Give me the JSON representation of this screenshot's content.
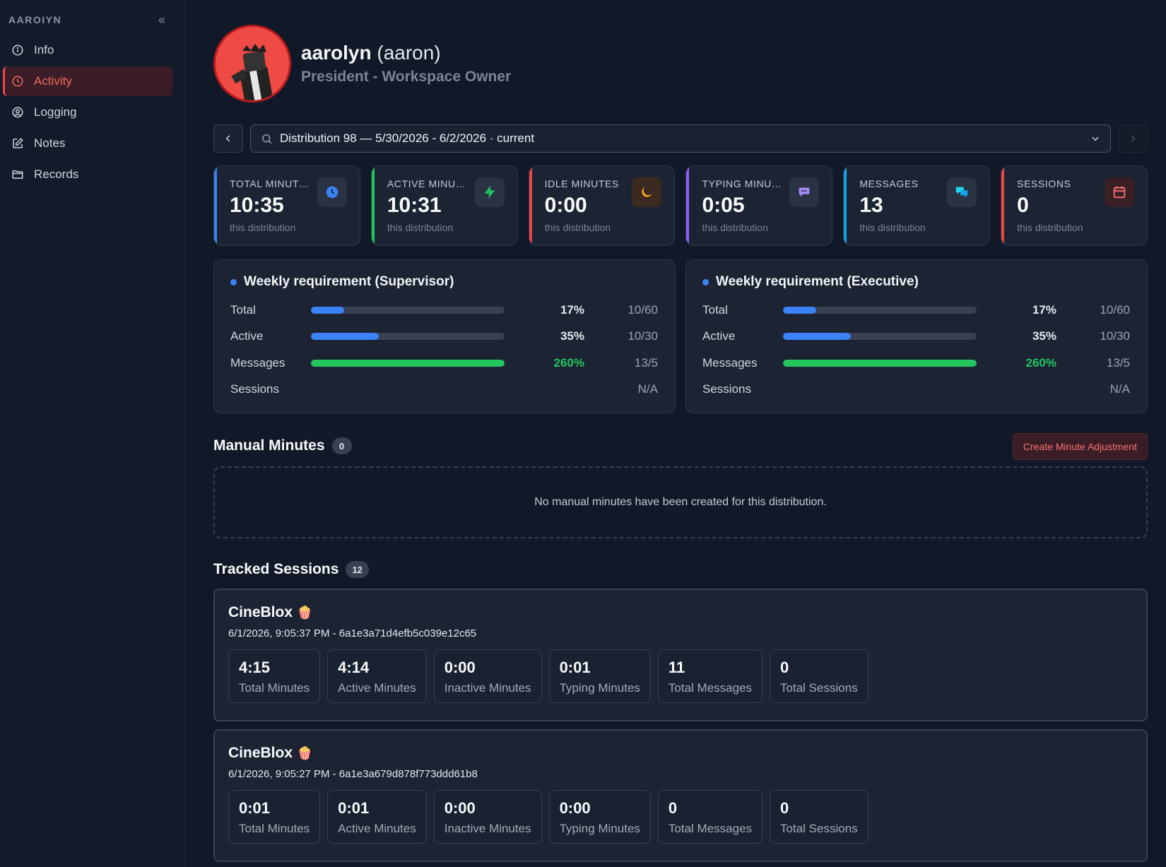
{
  "sidebar": {
    "brand": "AAROIYN",
    "collapse_icon": "double-chevron-left-icon",
    "items": [
      {
        "label": "Info",
        "icon": "info-icon",
        "active": false
      },
      {
        "label": "Activity",
        "icon": "clock-icon",
        "active": true
      },
      {
        "label": "Logging",
        "icon": "user-circle-icon",
        "active": false
      },
      {
        "label": "Notes",
        "icon": "edit-icon",
        "active": false
      },
      {
        "label": "Records",
        "icon": "folder-icon",
        "active": false
      }
    ]
  },
  "profile": {
    "name": "aarolyn",
    "nickname": "(aaron)",
    "role": "President - Workspace Owner"
  },
  "distribution": {
    "selected": "Distribution 98 — 5/30/2026 - 6/2/2026 · current"
  },
  "stats": [
    {
      "label": "TOTAL MINUTES",
      "value": "10:35",
      "sub": "this distribution",
      "icon": "clock-icon",
      "color": "#3b82f6"
    },
    {
      "label": "ACTIVE MINUTES",
      "value": "10:31",
      "sub": "this distribution",
      "icon": "bolt-icon",
      "color": "#22c55e"
    },
    {
      "label": "IDLE MINUTES",
      "value": "0:00",
      "sub": "this distribution",
      "icon": "moon-icon",
      "color": "#ef4444"
    },
    {
      "label": "TYPING MINUTES",
      "value": "0:05",
      "sub": "this distribution",
      "icon": "chat-typing-icon",
      "color": "#8b5cf6"
    },
    {
      "label": "MESSAGES",
      "value": "13",
      "sub": "this distribution",
      "icon": "chat-bubbles-icon",
      "color": "#0ea5e9"
    },
    {
      "label": "SESSIONS",
      "value": "0",
      "sub": "this distribution",
      "icon": "calendar-icon",
      "color": "#ef4444"
    }
  ],
  "requirements": [
    {
      "title": "Weekly requirement (Supervisor)",
      "rows": [
        {
          "label": "Total",
          "progress": 0.17,
          "pct": "17%",
          "frac": "10/60",
          "color": "#3b82f6"
        },
        {
          "label": "Active",
          "progress": 0.35,
          "pct": "35%",
          "frac": "10/30",
          "color": "#3b82f6"
        },
        {
          "label": "Messages",
          "progress": 1.0,
          "pct": "260%",
          "frac": "13/5",
          "color": "#22c55e"
        },
        {
          "label": "Sessions",
          "progress": null,
          "pct": "",
          "frac": "N/A",
          "color": ""
        }
      ]
    },
    {
      "title": "Weekly requirement (Executive)",
      "rows": [
        {
          "label": "Total",
          "progress": 0.17,
          "pct": "17%",
          "frac": "10/60",
          "color": "#3b82f6"
        },
        {
          "label": "Active",
          "progress": 0.35,
          "pct": "35%",
          "frac": "10/30",
          "color": "#3b82f6"
        },
        {
          "label": "Messages",
          "progress": 1.0,
          "pct": "260%",
          "frac": "13/5",
          "color": "#22c55e"
        },
        {
          "label": "Sessions",
          "progress": null,
          "pct": "",
          "frac": "N/A",
          "color": ""
        }
      ]
    }
  ],
  "manual": {
    "title": "Manual Minutes",
    "count": "0",
    "create_label": "Create Minute Adjustment",
    "empty_text": "No manual minutes have been created for this distribution."
  },
  "tracked": {
    "title": "Tracked Sessions",
    "count": "12",
    "sessions": [
      {
        "game": "CineBlox",
        "emoji": "🍿",
        "meta": "6/1/2026, 9:05:37 PM - 6a1e3a71d4efb5c039e12c65",
        "stats": [
          {
            "value": "4:15",
            "label": "Total Minutes"
          },
          {
            "value": "4:14",
            "label": "Active Minutes"
          },
          {
            "value": "0:00",
            "label": "Inactive Minutes"
          },
          {
            "value": "0:01",
            "label": "Typing Minutes"
          },
          {
            "value": "11",
            "label": "Total Messages"
          },
          {
            "value": "0",
            "label": "Total Sessions"
          }
        ]
      },
      {
        "game": "CineBlox",
        "emoji": "🍿",
        "meta": "6/1/2026, 9:05:27 PM - 6a1e3a679d878f773ddd61b8",
        "stats": [
          {
            "value": "0:01",
            "label": "Total Minutes"
          },
          {
            "value": "0:01",
            "label": "Active Minutes"
          },
          {
            "value": "0:00",
            "label": "Inactive Minutes"
          },
          {
            "value": "0:00",
            "label": "Typing Minutes"
          },
          {
            "value": "0",
            "label": "Total Messages"
          },
          {
            "value": "0",
            "label": "Total Sessions"
          }
        ]
      }
    ]
  }
}
